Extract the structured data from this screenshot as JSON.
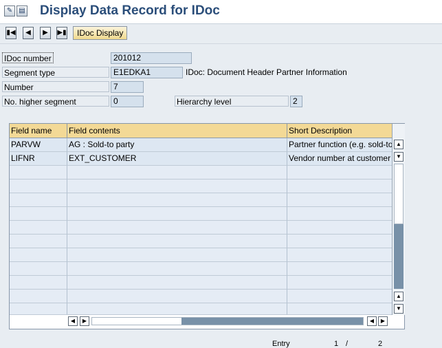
{
  "title": "Display Data Record for IDoc",
  "icons": {
    "tool1": "display-change-icon",
    "tool2": "document-icon"
  },
  "toolbar": {
    "first": "first-page-icon",
    "prev": "previous-page-icon",
    "next": "next-page-icon",
    "last": "last-page-icon",
    "idoc_display_label": "IDoc Display"
  },
  "header": {
    "idoc_number_label": "IDoc number",
    "idoc_number_value": "201012",
    "segment_type_label": "Segment type",
    "segment_type_value": "E1EDKA1",
    "segment_description": "IDoc: Document Header Partner Information",
    "number_label": "Number",
    "number_value": "7",
    "higher_segment_label": "No. higher segment",
    "higher_segment_value": "0",
    "hierarchy_level_label": "Hierarchy level",
    "hierarchy_level_value": "2"
  },
  "table": {
    "columns": [
      "Field name",
      "Field contents",
      "Short Description"
    ],
    "rows": [
      [
        "PARVW",
        "AG  : Sold-to party",
        "Partner function (e.g. sold-to"
      ],
      [
        "LIFNR",
        "EXT_CUSTOMER",
        "Vendor number at customer"
      ]
    ]
  },
  "footer": {
    "entry_label": "Entry",
    "entry_current": "1",
    "separator": "/",
    "entry_total": "2"
  },
  "colors": {
    "accent": "#2b4e7a",
    "header_bg": "#f3d996",
    "field_bg": "#d5e1ed"
  }
}
